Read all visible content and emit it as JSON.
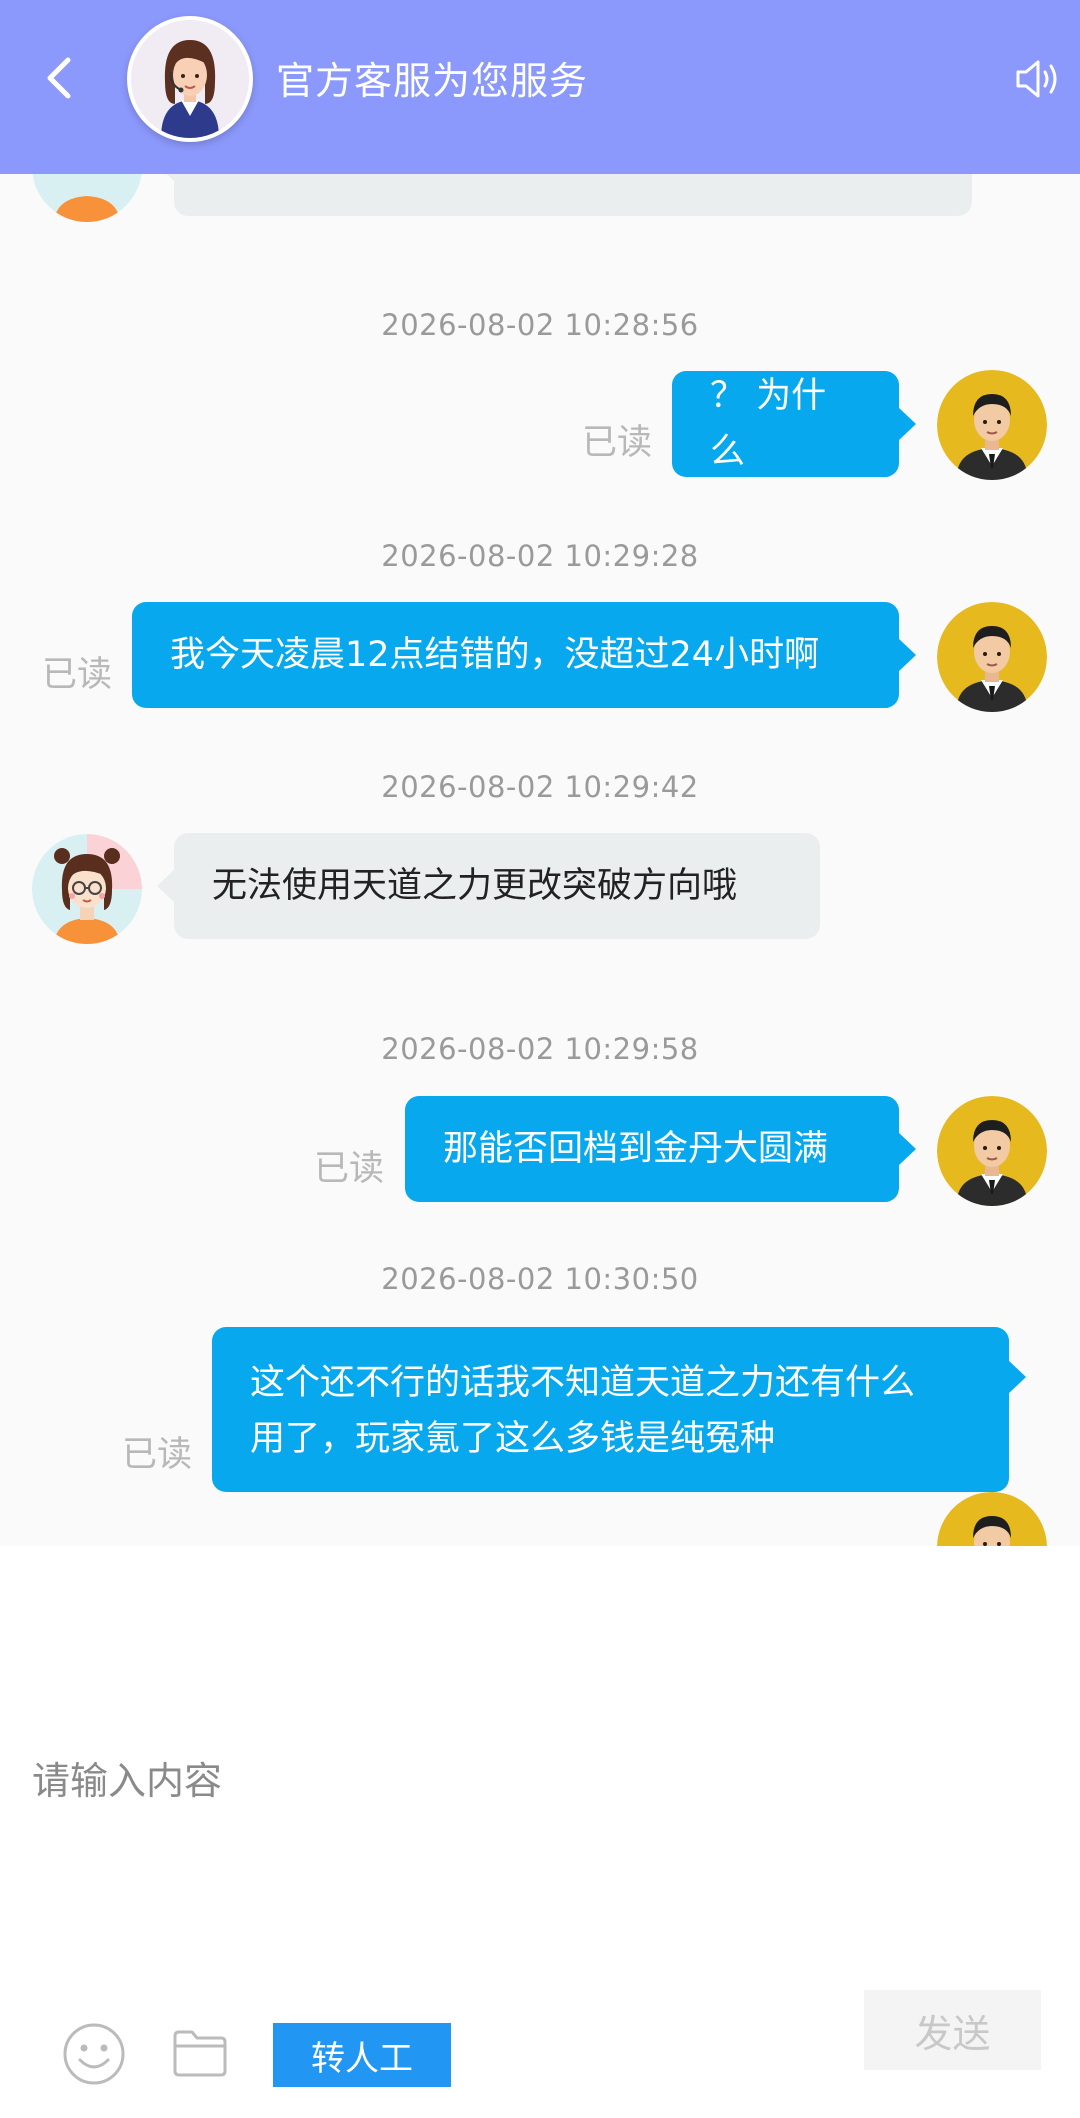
{
  "header": {
    "title": "官方客服为您服务",
    "color": "#8c99fc"
  },
  "messages": [
    {
      "time": "2026-08-02 10:28:56",
      "direction": "out",
      "text": "？ 为什么",
      "read": "已读"
    },
    {
      "time": "2026-08-02 10:29:28",
      "direction": "out",
      "text": "我今天凌晨12点结错的，没超过24小时啊",
      "read": "已读"
    },
    {
      "time": "2026-08-02 10:29:42",
      "direction": "in",
      "text": "无法使用天道之力更改突破方向哦"
    },
    {
      "time": "2026-08-02 10:29:58",
      "direction": "out",
      "text": "那能否回档到金丹大圆满",
      "read": "已读"
    },
    {
      "time": "2026-08-02 10:30:50",
      "direction": "out",
      "text_lines": [
        "这个还不行的话我不知道天道之力还有什么",
        "用了，玩家氪了这么多钱是纯冤种"
      ],
      "read": "已读"
    }
  ],
  "input": {
    "placeholder": "请输入内容"
  },
  "toolbar": {
    "emoji_icon": "smiley-icon",
    "folder_icon": "folder-icon",
    "transfer_label": "转人工",
    "send_label": "发送"
  },
  "colors": {
    "outgoing_bubble": "#08a8ee",
    "incoming_bubble": "#ebeeef",
    "transfer_button": "#2196f3"
  }
}
